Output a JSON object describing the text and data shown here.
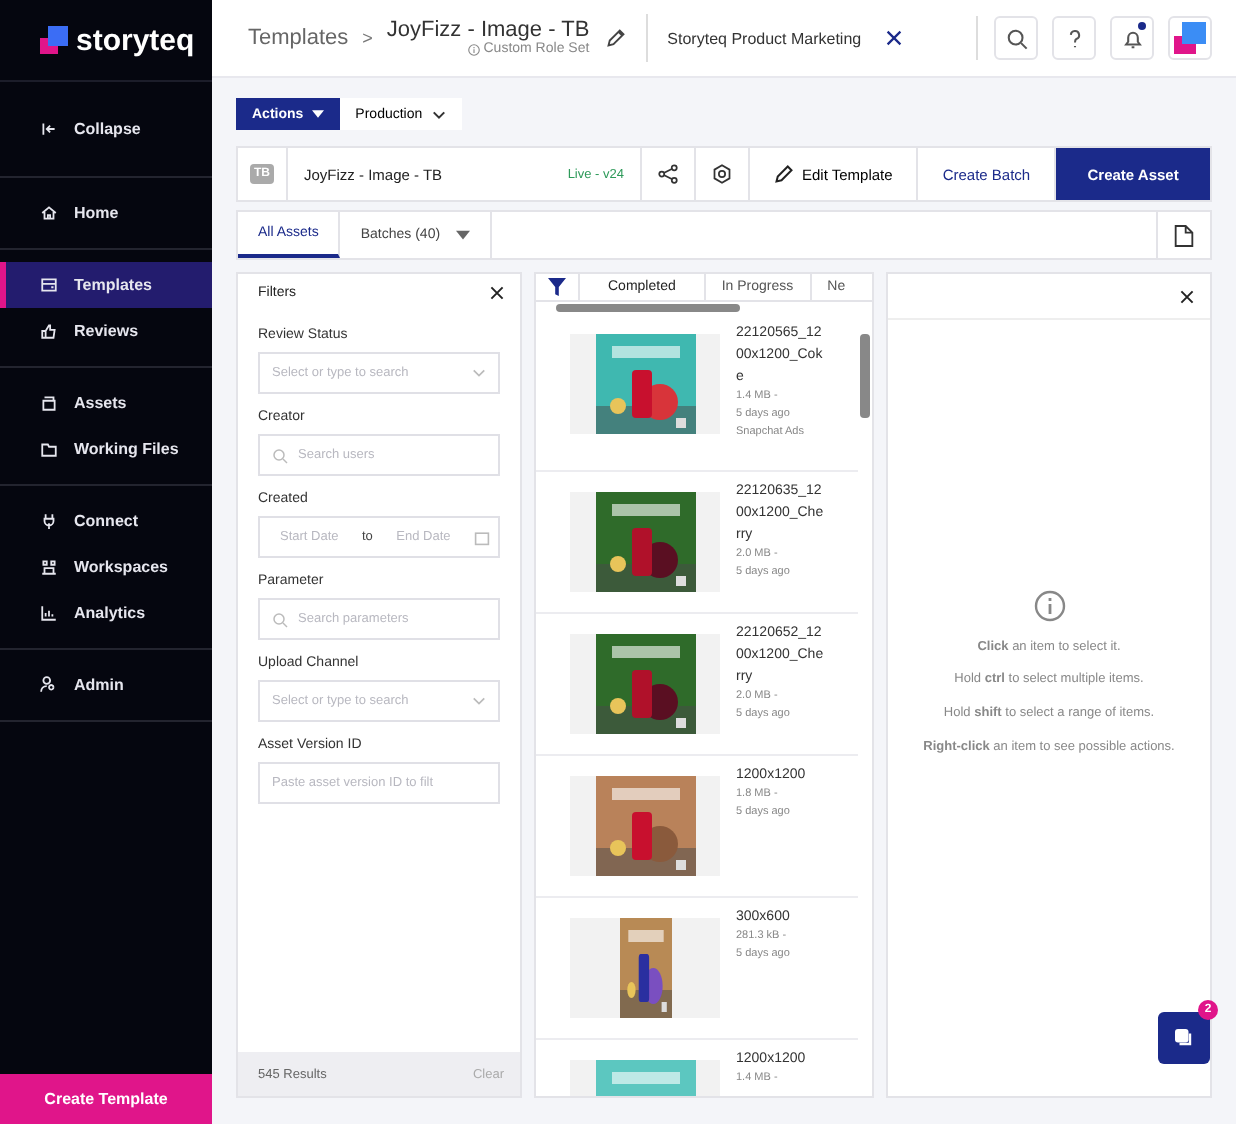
{
  "sidebar": {
    "logo": "storyteq",
    "groups": [
      [
        {
          "label": "Collapse",
          "selected": false
        }
      ],
      [
        {
          "label": "Home",
          "selected": false
        }
      ],
      [
        {
          "label": "Templates",
          "selected": true
        },
        {
          "label": "Reviews",
          "selected": false
        }
      ],
      [
        {
          "label": "Assets",
          "selected": false
        },
        {
          "label": "Working Files",
          "selected": false
        }
      ],
      [
        {
          "label": "Connect",
          "selected": false
        },
        {
          "label": "Workspaces",
          "selected": false
        },
        {
          "label": "Analytics",
          "selected": false
        }
      ],
      [
        {
          "label": "Admin",
          "selected": false
        }
      ]
    ],
    "create_button": "Create Template"
  },
  "header": {
    "breadcrumb": "Templates",
    "separator": ">",
    "title": "JoyFizz - Image - TB",
    "role_note": "Custom Role Set",
    "workspace": "Storyteq Product Marketing",
    "notification": true
  },
  "toolbar": {
    "actions": "Actions",
    "production": "Production"
  },
  "template_bar": {
    "badge": "TB",
    "name": "JoyFizz - Image - TB",
    "status": "Live - v24",
    "edit": "Edit Template",
    "create_batch": "Create Batch",
    "create_asset": "Create Asset"
  },
  "tabs": [
    {
      "label": "All Assets",
      "selected": true
    },
    {
      "label": "Batches (40)",
      "selected": false
    }
  ],
  "filters": {
    "title": "Filters",
    "fields": [
      {
        "label": "Review Status",
        "kind": "select",
        "placeholder": "Select or type to search"
      },
      {
        "label": "Creator",
        "kind": "search",
        "placeholder": "Search users"
      },
      {
        "label": "Created",
        "kind": "date",
        "placeholder": "Start Date",
        "to": "to",
        "placeholder_end": "End Date"
      },
      {
        "label": "Parameter",
        "kind": "search",
        "placeholder": "Search parameters"
      },
      {
        "label": "Upload Channel",
        "kind": "select",
        "placeholder": "Select or type to search"
      },
      {
        "label": "Asset Version ID",
        "kind": "text",
        "placeholder": "Paste asset version ID to filt"
      }
    ],
    "results": "545 Results",
    "clear": "Clear"
  },
  "asset_tabs": [
    {
      "label": "Completed",
      "selected": true
    },
    {
      "label": "In Progress",
      "selected": false
    },
    {
      "label": "Ne",
      "selected": false
    }
  ],
  "assets": [
    {
      "name": "22120565_1200x1200_Coke",
      "size": "1.4 MB  -",
      "age": "5 days ago",
      "channel": "Snapchat Ads",
      "kind": "picture"
    },
    {
      "name": "22120635_1200x1200_Cherry",
      "size": "2.0 MB  -",
      "age": "5 days ago",
      "kind": "picture"
    },
    {
      "name": "22120652_1200x1200_Cherry",
      "size": "2.0 MB  -",
      "age": "5 days ago",
      "kind": "picture"
    },
    {
      "name": "1200x1200",
      "size": "1.8 MB  -",
      "age": "5 days ago",
      "kind": "picture"
    },
    {
      "name": "300x600",
      "size": "281.3 kB  -",
      "age": "5 days ago",
      "kind": "picture"
    },
    {
      "name": "1200x1200",
      "size": "1.4 MB  -",
      "kind": "picture"
    }
  ],
  "details": {
    "hints": [
      "**Click** an item to select it.",
      "Hold **ctrl** to select multiple items.",
      "Hold **shift** to select a range of items.",
      "**Right-click** an item to see possible actions."
    ]
  },
  "help": {
    "badge": "2"
  }
}
